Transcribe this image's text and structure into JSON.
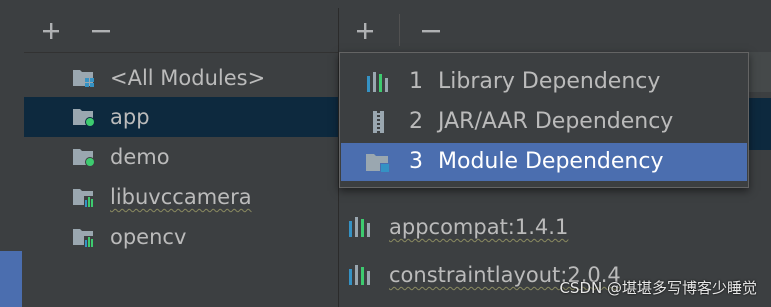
{
  "toolbar_left": {
    "add_icon": "plus-icon",
    "remove_icon": "minus-icon"
  },
  "toolbar_right": {
    "add_icon": "plus-icon",
    "remove_icon": "minus-icon"
  },
  "modules": [
    {
      "label": "<All Modules>",
      "icon": "all-modules-icon",
      "selected": false,
      "underlined": false
    },
    {
      "label": "app",
      "icon": "module-folder-icon",
      "selected": true,
      "underlined": false
    },
    {
      "label": "demo",
      "icon": "module-folder-icon",
      "selected": false,
      "underlined": false
    },
    {
      "label": "libuvccamera",
      "icon": "library-module-icon",
      "selected": false,
      "underlined": true
    },
    {
      "label": "opencv",
      "icon": "library-module-icon",
      "selected": false,
      "underlined": false
    }
  ],
  "dependencies": [
    {
      "label": "appcompat:1.4.1",
      "icon": "library-bars-icon"
    },
    {
      "label": "constraintlayout:2.0.4",
      "icon": "library-bars-icon"
    }
  ],
  "popup": {
    "items": [
      {
        "number": "1",
        "label": "Library Dependency",
        "icon": "library-bars-icon",
        "active": false
      },
      {
        "number": "2",
        "label": "JAR/AAR Dependency",
        "icon": "jar-archive-icon",
        "active": false
      },
      {
        "number": "3",
        "label": "Module Dependency",
        "icon": "module-folder-icon",
        "active": true
      }
    ]
  },
  "watermark": "CSDN @堪堪多写博客少睡觉",
  "colors": {
    "background": "#3c3f41",
    "selected_row": "#0d293e",
    "popup_active": "#4b6eaf",
    "text": "#bbbbbb",
    "badge_green": "#3dcb6f",
    "badge_blue": "#3592c4"
  }
}
